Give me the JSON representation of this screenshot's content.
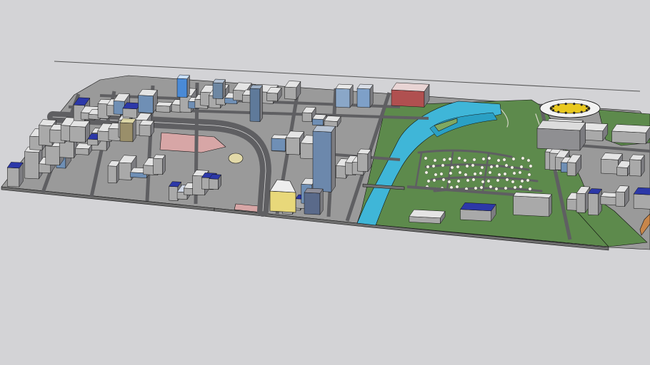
{
  "view": {
    "background": "#d3d3d6",
    "colors": {
      "base": "#9a9a9a",
      "road": "#5f5f62",
      "road_line": "#d8d8d8",
      "park": "#5d8a4c",
      "park_light": "#7fa862",
      "water": "#3fb6d8",
      "roof": "#e4e4e4",
      "wall": "#a9a9a9",
      "wall_dark": "#7c7c80",
      "glass": "#6f8fb5",
      "accent_blue": "#2c38a8",
      "plaza_pink": "#d7a6a6",
      "stadium_roof": "#f2f2f2",
      "stadium_seats": "#e8c81e",
      "tree": "#f4f4e6",
      "edge": "#111111"
    }
  }
}
